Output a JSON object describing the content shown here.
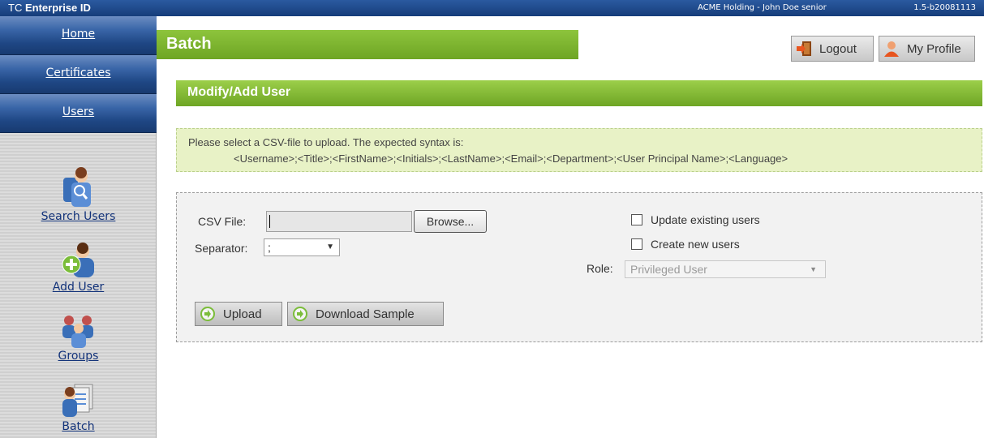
{
  "topbar": {
    "brand_prefix": "TC",
    "brand_name": "Enterprise ID",
    "account": "ACME Holding - John Doe senior",
    "version": "1.5-b20081113"
  },
  "nav": {
    "home": "Home",
    "certificates": "Certificates",
    "users": "Users"
  },
  "sidebar": {
    "search_users": "Search Users",
    "add_user": "Add User",
    "groups": "Groups",
    "batch": "Batch"
  },
  "header": {
    "title": "Batch",
    "logout": "Logout",
    "my_profile": "My Profile"
  },
  "section": {
    "title": "Modify/Add User"
  },
  "info": {
    "line1": "Please select a CSV-file to upload. The expected syntax is:",
    "syntax": "<Username>;<Title>;<FirstName>;<Initials>;<LastName>;<Email>;<Department>;<User Principal Name>;<Language>"
  },
  "form": {
    "csv_label": "CSV File:",
    "csv_value": "",
    "browse": "Browse...",
    "separator_label": "Separator:",
    "separator_value": ";",
    "update_existing": "Update existing users",
    "update_existing_checked": false,
    "create_new": "Create new users",
    "create_new_checked": false,
    "role_label": "Role:",
    "role_value": "Privileged User",
    "upload": "Upload",
    "download_sample": "Download Sample"
  },
  "colors": {
    "nav_blue": "#1f4785",
    "header_green": "#6ea524",
    "info_bg": "#e8f2c6",
    "link_blue": "#13337a"
  }
}
